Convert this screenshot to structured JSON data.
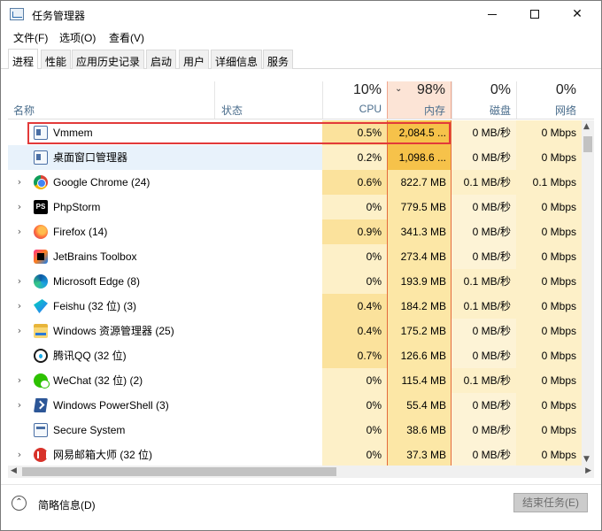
{
  "window": {
    "title": "任务管理器"
  },
  "menu": [
    "文件(F)",
    "选项(O)",
    "查看(V)"
  ],
  "tabs": [
    "进程",
    "性能",
    "应用历史记录",
    "启动",
    "用户",
    "详细信息",
    "服务"
  ],
  "active_tab": "进程",
  "header": {
    "name": "名称",
    "status": "状态",
    "cpu": {
      "pct": "10%",
      "label": "CPU"
    },
    "memory": {
      "pct": "98%",
      "label": "内存",
      "sort": "descending"
    },
    "disk": {
      "pct": "0%",
      "label": "磁盘"
    },
    "network": {
      "pct": "0%",
      "label": "网络"
    }
  },
  "processes": [
    {
      "name": "Vmmem",
      "icon": "vm-icon",
      "expandable": false,
      "cpu": "0.5%",
      "memory": "2,084.5 ...",
      "disk": "0 MB/秒",
      "network": "0 Mbps"
    },
    {
      "name": "桌面窗口管理器",
      "icon": "window-icon",
      "expandable": false,
      "cpu": "0.2%",
      "memory": "1,098.6 ...",
      "disk": "0 MB/秒",
      "network": "0 Mbps"
    },
    {
      "name": "Google Chrome (24)",
      "icon": "chrome-icon",
      "expandable": true,
      "cpu": "0.6%",
      "memory": "822.7 MB",
      "disk": "0.1 MB/秒",
      "network": "0.1 Mbps"
    },
    {
      "name": "PhpStorm",
      "icon": "phpstorm-icon",
      "expandable": true,
      "cpu": "0%",
      "memory": "779.5 MB",
      "disk": "0 MB/秒",
      "network": "0 Mbps"
    },
    {
      "name": "Firefox (14)",
      "icon": "firefox-icon",
      "expandable": true,
      "cpu": "0.9%",
      "memory": "341.3 MB",
      "disk": "0 MB/秒",
      "network": "0 Mbps"
    },
    {
      "name": "JetBrains Toolbox",
      "icon": "jetbrains-icon",
      "expandable": false,
      "cpu": "0%",
      "memory": "273.4 MB",
      "disk": "0 MB/秒",
      "network": "0 Mbps"
    },
    {
      "name": "Microsoft Edge (8)",
      "icon": "edge-icon",
      "expandable": true,
      "cpu": "0%",
      "memory": "193.9 MB",
      "disk": "0.1 MB/秒",
      "network": "0 Mbps"
    },
    {
      "name": "Feishu (32 位) (3)",
      "icon": "feishu-icon",
      "expandable": true,
      "cpu": "0.4%",
      "memory": "184.2 MB",
      "disk": "0.1 MB/秒",
      "network": "0 Mbps"
    },
    {
      "name": "Windows 资源管理器 (25)",
      "icon": "folder-icon",
      "expandable": true,
      "cpu": "0.4%",
      "memory": "175.2 MB",
      "disk": "0 MB/秒",
      "network": "0 Mbps"
    },
    {
      "name": "腾讯QQ (32 位)",
      "icon": "qq-icon",
      "expandable": false,
      "cpu": "0.7%",
      "memory": "126.6 MB",
      "disk": "0 MB/秒",
      "network": "0 Mbps"
    },
    {
      "name": "WeChat (32 位) (2)",
      "icon": "wechat-icon",
      "expandable": true,
      "cpu": "0%",
      "memory": "115.4 MB",
      "disk": "0.1 MB/秒",
      "network": "0 Mbps"
    },
    {
      "name": "Windows PowerShell (3)",
      "icon": "powershell-icon",
      "expandable": true,
      "cpu": "0%",
      "memory": "55.4 MB",
      "disk": "0 MB/秒",
      "network": "0 Mbps"
    },
    {
      "name": "Secure System",
      "icon": "secure-system-icon",
      "expandable": false,
      "cpu": "0%",
      "memory": "38.6 MB",
      "disk": "0 MB/秒",
      "network": "0 Mbps"
    },
    {
      "name": "网易邮箱大师 (32 位)",
      "icon": "mail-master-icon",
      "expandable": true,
      "cpu": "0%",
      "memory": "37.3 MB",
      "disk": "0 MB/秒",
      "network": "0 Mbps"
    }
  ],
  "footer": {
    "fewer_details": "简略信息(D)",
    "end_task": "结束任务(E)"
  },
  "colors": {
    "highlight": "#e23a3a",
    "memory_sort_column": "#fce4d6",
    "heat_high": "#f6c24a",
    "heat_low": "#fdf0c8"
  }
}
